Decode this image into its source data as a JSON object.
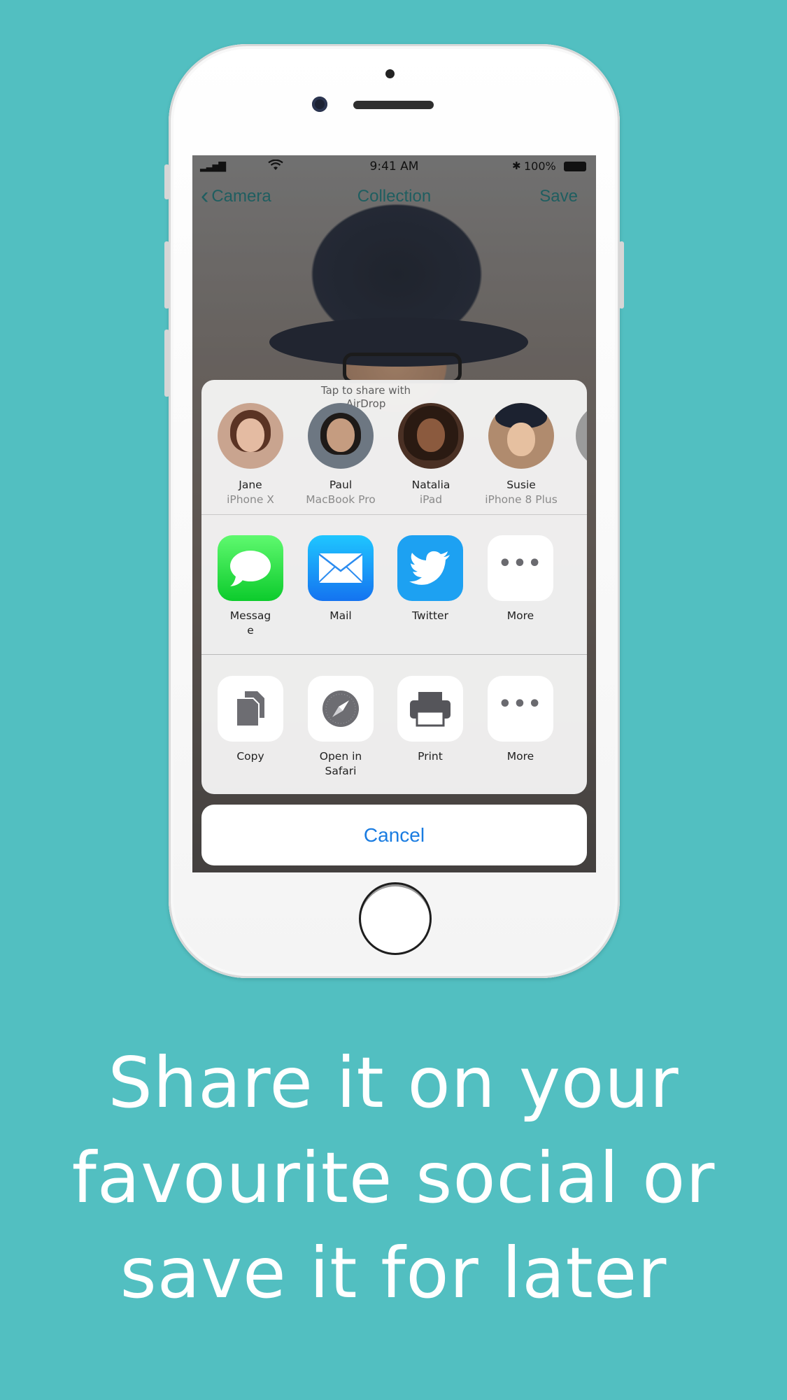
{
  "status_bar": {
    "time": "9:41 AM",
    "battery": "100%"
  },
  "nav": {
    "back_label": "Camera",
    "title": "Collection",
    "save_label": "Save"
  },
  "share_sheet": {
    "airdrop_title": "Tap to share with AirDrop",
    "people": [
      {
        "name": "Jane",
        "device": "iPhone X"
      },
      {
        "name": "Paul",
        "device": "MacBook Pro"
      },
      {
        "name": "Natalia",
        "device": "iPad"
      },
      {
        "name": "Susie",
        "device": "iPhone 8 Plus"
      }
    ],
    "share_apps": [
      {
        "label": "Messag\ne",
        "icon": "messages-icon"
      },
      {
        "label": "Mail",
        "icon": "mail-icon"
      },
      {
        "label": "Twitter",
        "icon": "twitter-icon"
      },
      {
        "label": "More",
        "icon": "more-icon"
      }
    ],
    "actions": [
      {
        "label": "Copy",
        "icon": "copy-icon"
      },
      {
        "label": "Open in\nSafari",
        "icon": "safari-icon"
      },
      {
        "label": "Print",
        "icon": "print-icon"
      },
      {
        "label": "More",
        "icon": "more-icon"
      }
    ],
    "cancel_label": "Cancel"
  },
  "caption": {
    "line1": "Share it on your",
    "line2": "favourite social or",
    "line3": "save it for later"
  },
  "colors": {
    "background": "#52bfc1",
    "accent_blue": "#1a7ce1",
    "nav_tint": "#1f5e60",
    "caption_text": "#ffffff"
  }
}
